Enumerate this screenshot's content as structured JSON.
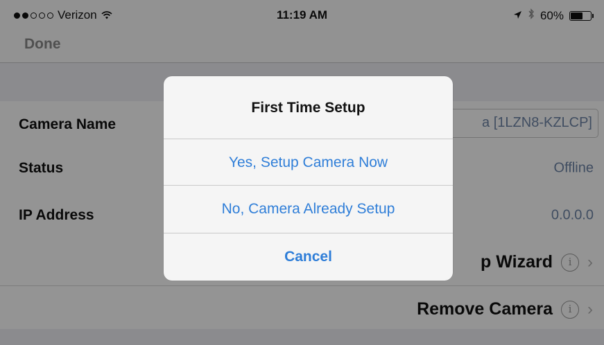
{
  "status_bar": {
    "carrier": "Verizon",
    "time": "11:19 AM",
    "battery_percent": "60%",
    "battery_level": 0.6,
    "signal_bars_filled": 2,
    "signal_bars_total": 5,
    "icons": [
      "wifi-icon",
      "location-arrow-icon",
      "bluetooth-icon",
      "battery-icon"
    ]
  },
  "navbar": {
    "done_label": "Done"
  },
  "table": {
    "camera_name_label": "Camera Name",
    "camera_name_value": "a [1LZN8-KZLCP]",
    "status_label": "Status",
    "status_value": "Offline",
    "ip_label": "IP Address",
    "ip_value": "0.0.0.0",
    "wizard_label": "p Wizard",
    "remove_label": "Remove Camera",
    "info_icon_glyph": "i",
    "chevron_glyph": "›"
  },
  "alert": {
    "title": "First Time Setup",
    "buttons": [
      {
        "label": "Yes, Setup Camera Now"
      },
      {
        "label": "No, Camera Already Setup"
      },
      {
        "label": "Cancel"
      }
    ]
  },
  "colors": {
    "accent": "#2f7ed8",
    "value_text": "#6e86a8",
    "overlay": "rgba(0,0,0,0.42)"
  }
}
